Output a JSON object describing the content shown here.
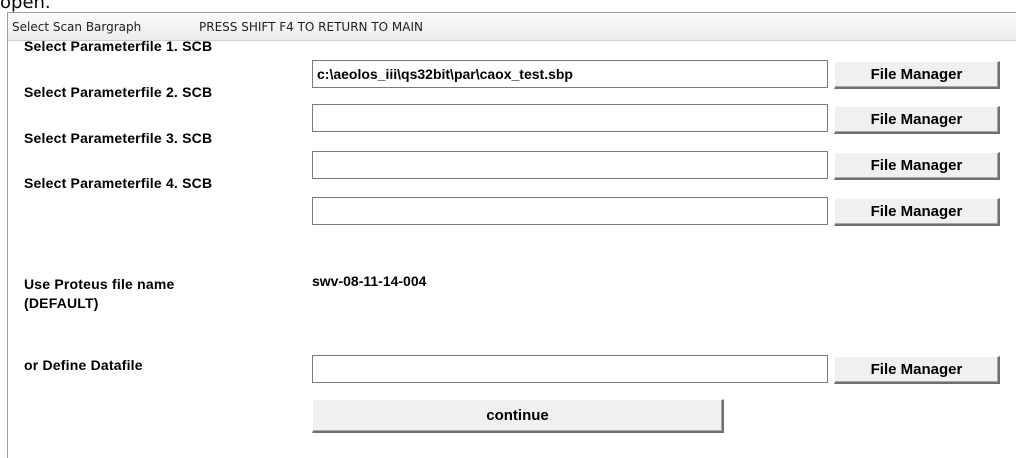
{
  "page_top_text": "open.",
  "window": {
    "title_left": "Select Scan Bargraph",
    "title_right": "PRESS SHIFT F4 TO RETURN TO MAIN"
  },
  "parameter_rows": [
    {
      "label": "Select Parameterfile 1. SCB",
      "value": "c:\\aeolos_iii\\qs32bit\\par\\caox_test.sbp",
      "button": "File Manager"
    },
    {
      "label": "Select Parameterfile 2. SCB",
      "value": "",
      "button": "File Manager"
    },
    {
      "label": "Select Parameterfile 3. SCB",
      "value": "",
      "button": "File Manager"
    },
    {
      "label": "Select Parameterfile 4. SCB",
      "value": "",
      "button": "File Manager"
    }
  ],
  "proteus": {
    "label_line1": "Use Proteus file name",
    "label_line2": "(DEFAULT)",
    "value": "swv-08-11-14-004"
  },
  "datafile": {
    "label": "or Define Datafile",
    "value": "",
    "button": "File Manager"
  },
  "continue_label": "continue"
}
